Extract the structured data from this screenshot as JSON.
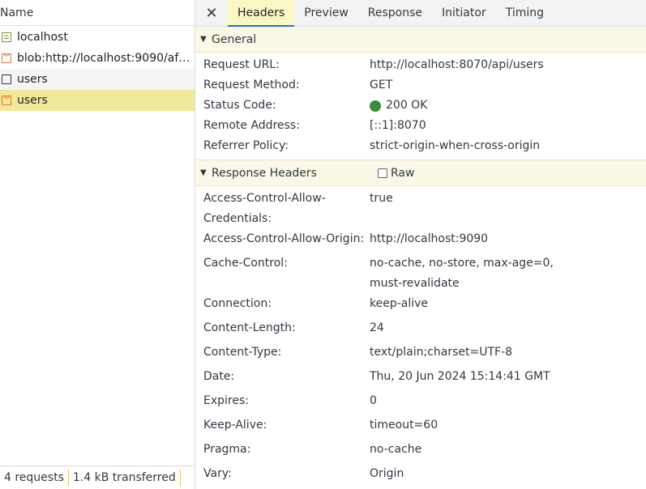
{
  "requests_panel": {
    "header": "Name",
    "items": [
      {
        "name": "localhost",
        "icon": "document-icon"
      },
      {
        "name": "blob:http://localhost:9090/af2...",
        "icon": "script-icon"
      },
      {
        "name": "users",
        "icon": "fetch-icon"
      },
      {
        "name": "users",
        "icon": "script-icon"
      }
    ],
    "footer": {
      "requests": "4 requests",
      "transferred": "1.4 kB transferred"
    }
  },
  "detail_tabs": {
    "close_label": "✕",
    "tabs": [
      "Headers",
      "Preview",
      "Response",
      "Initiator",
      "Timing"
    ],
    "active": "Headers"
  },
  "general": {
    "title": "General",
    "rows": [
      {
        "key": "Request URL:",
        "value": "http://localhost:8070/api/users"
      },
      {
        "key": "Request Method:",
        "value": "GET"
      },
      {
        "key": "Status Code:",
        "value": "200 OK"
      },
      {
        "key": "Remote Address:",
        "value": "[::1]:8070"
      },
      {
        "key": "Referrer Policy:",
        "value": "strict-origin-when-cross-origin"
      }
    ]
  },
  "response_headers": {
    "title": "Response Headers",
    "raw_label": "Raw",
    "raw_checked": false,
    "rows": [
      {
        "key": "Access-Control-Allow-Credentials:",
        "value": "true"
      },
      {
        "key": "Access-Control-Allow-Origin:",
        "value": "http://localhost:9090"
      },
      {
        "key": "Cache-Control:",
        "value": "no-cache, no-store, max-age=0, must-revalidate"
      },
      {
        "key": "Connection:",
        "value": "keep-alive"
      },
      {
        "key": "Content-Length:",
        "value": "24"
      },
      {
        "key": "Content-Type:",
        "value": "text/plain;charset=UTF-8"
      },
      {
        "key": "Date:",
        "value": "Thu, 20 Jun 2024 15:14:41 GMT"
      },
      {
        "key": "Expires:",
        "value": "0"
      },
      {
        "key": "Keep-Alive:",
        "value": "timeout=60"
      },
      {
        "key": "Pragma:",
        "value": "no-cache"
      },
      {
        "key": "Vary:",
        "value": "Origin"
      }
    ]
  },
  "colors": {
    "status_ok": "#3c8b3c",
    "selected_row": "#efe998",
    "active_tab": "#fbf7c5"
  }
}
